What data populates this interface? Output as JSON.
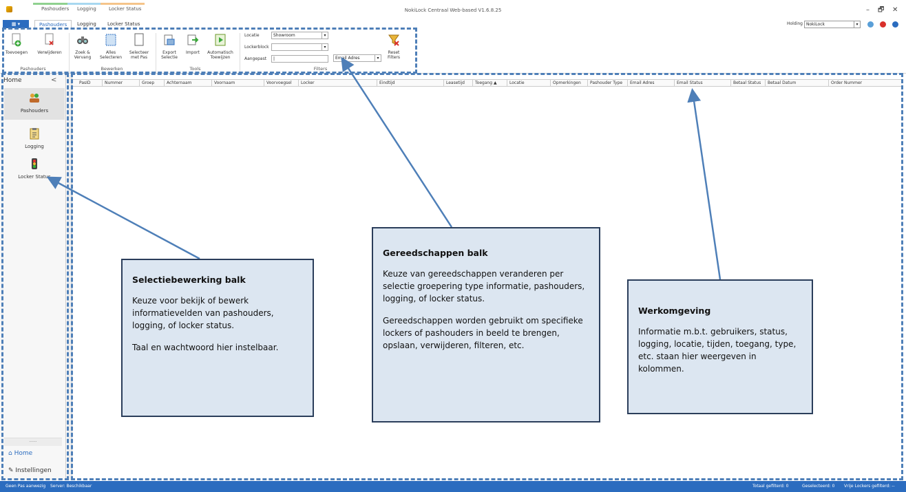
{
  "window": {
    "title": "NokiLock Centraal Web-based V1.6.8.25",
    "minimize": "–",
    "restore": "🗗",
    "close": "✕"
  },
  "context_tabs": [
    {
      "label": "Pashouders",
      "color": "#8fd18f"
    },
    {
      "label": "Logging",
      "color": "#a8d8f0"
    },
    {
      "label": "Locker Status",
      "color": "#f5c48a"
    }
  ],
  "ribbon_tabs": {
    "file": "▦ ▾",
    "tabs": [
      "Pashouders",
      "Logging",
      "Locker Status"
    ],
    "active": "Pashouders"
  },
  "holding": {
    "label": "Holding",
    "value": "NokiLock"
  },
  "ribbon": {
    "buttons": [
      {
        "label": "Toevoegen",
        "icon": "add-doc-icon"
      },
      {
        "label": "Verwijderen",
        "icon": "delete-doc-icon"
      },
      {
        "label": "Zoek & Vervang",
        "icon": "binoculars-icon"
      },
      {
        "label": "Alles Selecteren",
        "icon": "select-all-icon"
      },
      {
        "label": "Selecteer met Pas",
        "icon": "card-icon"
      },
      {
        "label": "Export Selectie",
        "icon": "export-icon"
      },
      {
        "label": "Import",
        "icon": "import-icon"
      },
      {
        "label": "Automatisch Toewijzen",
        "icon": "auto-assign-icon"
      },
      {
        "label": "Reset Filters",
        "icon": "reset-filter-icon"
      }
    ],
    "groups": [
      "Pashouders",
      "Bewerken",
      "Tools",
      "Filters"
    ],
    "filters": {
      "locatie_label": "Locatie",
      "locatie_value": "Showroom",
      "lockerblock_label": "Lockerblock",
      "lockerblock_value": "",
      "aangepast_label": "Aangepast",
      "aangepast_value": "|",
      "field_value": "Email Adres"
    }
  },
  "sidebar": {
    "title": "Home",
    "collapse": "<",
    "items": [
      {
        "label": "Pashouders",
        "icon": "people-icon"
      },
      {
        "label": "Logging",
        "icon": "clipboard-icon"
      },
      {
        "label": "Locker Status",
        "icon": "traffic-light-icon"
      }
    ],
    "dots": "......",
    "home": "Home",
    "settings": "Instellingen"
  },
  "grid": {
    "columns": [
      "PasID",
      "Nummer",
      "Groep",
      "Achternaam",
      "Voornaam",
      "Voorvoegsel",
      "Locker",
      "Eindtijd",
      "Leasetijd",
      "Toegang ▲",
      "Locatie",
      "Opmerkingen",
      "Pashouder Type",
      "Email Adres",
      "Email Status",
      "Betaal Status",
      "Betaal Datum",
      "Order Nummer"
    ]
  },
  "status": {
    "pas": "Geen Pas aanwezig",
    "server": "Server: Beschikbaar",
    "totaal": "Totaal gefilterd: 0",
    "geselecteerd": "Geselecteerd: 0",
    "vrije": "Vrije Lockers gefilterd: --"
  },
  "callouts": [
    {
      "title": "Selectiebewerking balk",
      "paragraphs": [
        "Keuze voor bekijk of bewerk informatievelden van pashouders, logging, of locker status.",
        "Taal en wachtwoord hier instelbaar."
      ]
    },
    {
      "title": "Gereedschappen balk",
      "paragraphs": [
        "Keuze van gereedschappen veranderen per selectie groepering type informatie, pashouders, logging, of locker status.",
        "Gereedschappen worden gebruikt om specifieke lockers of pashouders in beeld te brengen, opslaan, verwijderen, filteren, etc."
      ]
    },
    {
      "title": "Werkomgeving",
      "paragraphs": [
        "Informatie m.b.t. gebruikers, status, logging, locatie, tijden, toegang, type, etc. staan hier weergeven in kolommen."
      ]
    }
  ],
  "colors": {
    "accent": "#2b6cbf",
    "annotation": "#4e7fb8",
    "callout_bg": "#dce6f1"
  }
}
